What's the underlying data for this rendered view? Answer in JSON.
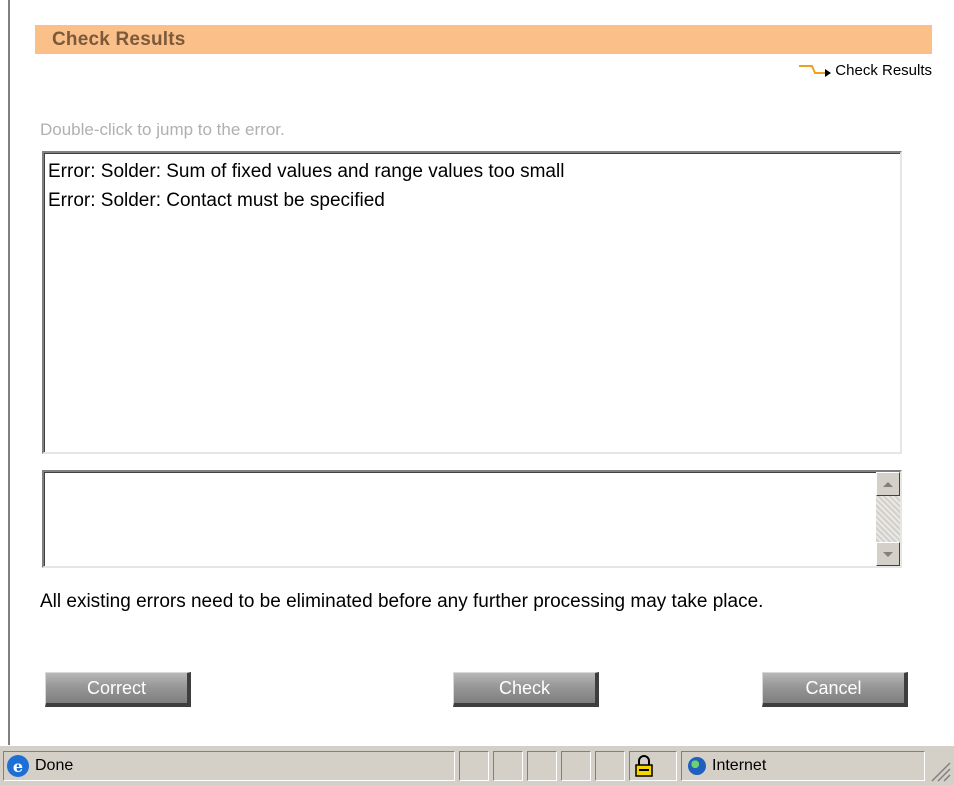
{
  "header": {
    "title": "Check Results"
  },
  "breadcrumb": {
    "label": "Check Results"
  },
  "hint": "Double-click to jump to the error.",
  "errors": [
    "Error: Solder: Sum of fixed values and range values too small",
    "Error: Solder: Contact must be specified"
  ],
  "detail": {
    "value": ""
  },
  "notice": "All existing errors need to be eliminated before any further processing may take place.",
  "buttons": {
    "correct": "Correct",
    "check": "Check",
    "cancel": "Cancel"
  },
  "statusbar": {
    "status": "Done",
    "zone": "Internet"
  },
  "colors": {
    "header_bg": "#fbc08a",
    "header_text": "#7a5a3a",
    "breadcrumb_arrow": "#f0a020",
    "button_bg": "#9a9a9a"
  },
  "icons": [
    "ie-page-icon",
    "lock-icon",
    "globe-icon",
    "breadcrumb-arrow-icon",
    "scroll-up-icon",
    "scroll-down-icon",
    "resize-grip-icon"
  ]
}
